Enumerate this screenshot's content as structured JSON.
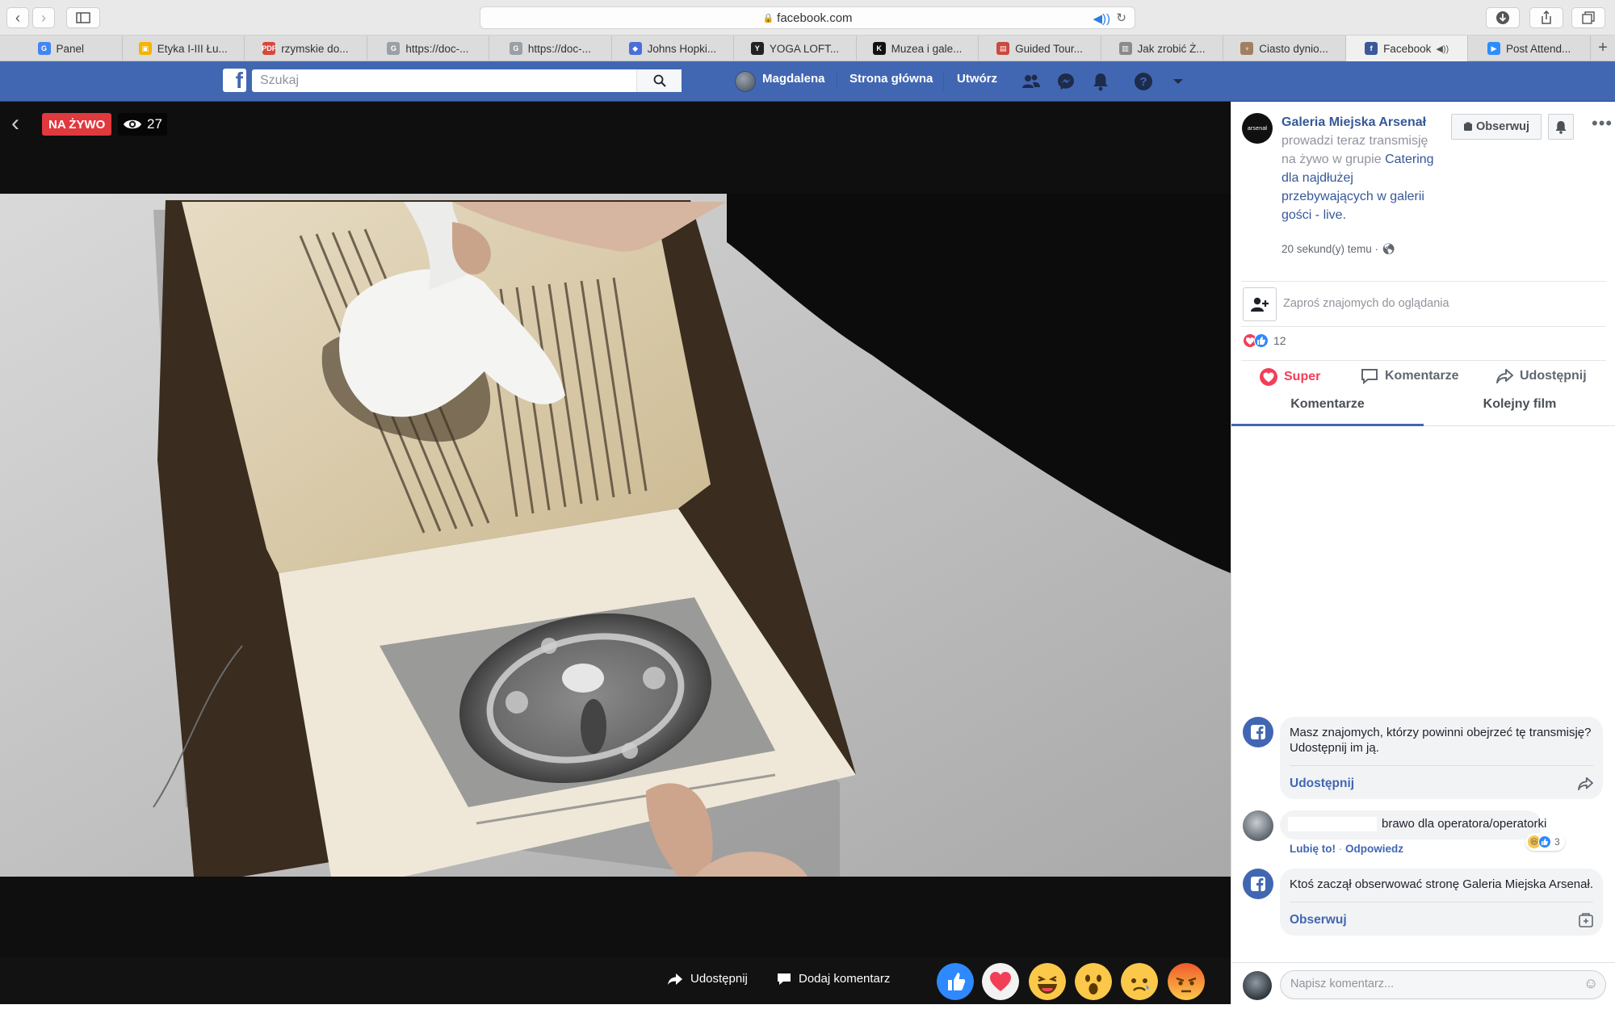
{
  "browser": {
    "url": "facebook.com",
    "tabs": [
      {
        "label": "Panel",
        "icon": "google-icon",
        "color": "#4285f4",
        "glyph": "G"
      },
      {
        "label": "Etyka I-III Łu...",
        "icon": "classroom-icon",
        "color": "#f4b400",
        "glyph": "▣"
      },
      {
        "label": "rzymskie do...",
        "icon": "pdf-icon",
        "color": "#d9473c",
        "glyph": "PDF"
      },
      {
        "label": "https://doc-...",
        "icon": "google-doc-icon",
        "color": "#9aa0a6",
        "glyph": "G"
      },
      {
        "label": "https://doc-...",
        "icon": "google-doc-icon",
        "color": "#9aa0a6",
        "glyph": "G"
      },
      {
        "label": "Johns Hopki...",
        "icon": "shield-icon",
        "color": "#4a6fd8",
        "glyph": "◆"
      },
      {
        "label": "YOGA LOFT...",
        "icon": "yoga-icon",
        "color": "#222222",
        "glyph": "Y"
      },
      {
        "label": "Muzea i gale...",
        "icon": "museum-icon",
        "color": "#111111",
        "glyph": "K"
      },
      {
        "label": "Guided Tour...",
        "icon": "tour-icon",
        "color": "#c94a3f",
        "glyph": "▤"
      },
      {
        "label": "Jak zrobić Ż...",
        "icon": "recipe-icon",
        "color": "#8a8a8a",
        "glyph": "▥"
      },
      {
        "label": "Ciasto dynio...",
        "icon": "cake-icon",
        "color": "#a08060",
        "glyph": "♆"
      },
      {
        "label": "Facebook",
        "icon": "facebook-icon",
        "color": "#3b5998",
        "glyph": "f",
        "active": true,
        "audio": "◀))"
      },
      {
        "label": "Post Attend...",
        "icon": "zoom-icon",
        "color": "#2d8cff",
        "glyph": "▶"
      }
    ]
  },
  "fb": {
    "search_placeholder": "Szukaj",
    "user_name": "Magdalena",
    "nav_home": "Strona główna",
    "nav_create": "Utwórz"
  },
  "video": {
    "live_label": "NA ŻYWO",
    "viewer_count": "27",
    "share_label": "Udostępnij",
    "comment_label": "Dodaj komentarz"
  },
  "post": {
    "page_name": "Galeria Miejska Arsenał",
    "avatar_text": "arsenał",
    "action_text": "prowadzi teraz transmisję na żywo w grupie",
    "group_name": "Catering dla najdłużej przebywających w galerii gości - live.",
    "time": "20 sekund(y) temu ·",
    "follow_label": "Obserwuj",
    "invite_text": "Zaproś znajomych do oglądania",
    "reaction_count": "12",
    "action_super": "Super",
    "action_comments": "Komentarze",
    "action_share": "Udostępnij",
    "tab_comments": "Komentarze",
    "tab_next": "Kolejny film"
  },
  "feed": {
    "share_prompt": "Masz znajomych, którzy powinni obejrzeć tę transmisję? Udostępnij im ją.",
    "share_link": "Udostępnij",
    "comment_text": "brawo dla operatora/operatorki",
    "comment_like": "Lubię to!",
    "comment_reply": "Odpowiedz",
    "comment_reactions": "3",
    "follow_notice": "Ktoś zaczął obserwować stronę Galeria Miejska Arsenał.",
    "follow_link": "Obserwuj",
    "composer_placeholder": "Napisz komentarz..."
  },
  "colors": {
    "fb_blue": "#4267b2",
    "live_red": "#e0393e",
    "link_blue": "#365899"
  }
}
